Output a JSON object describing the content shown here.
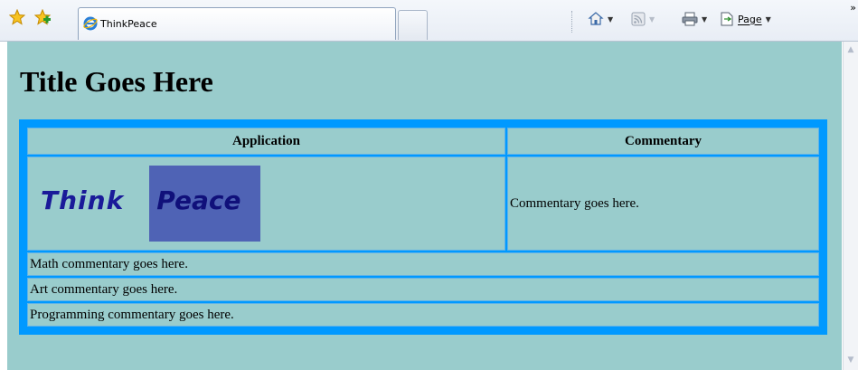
{
  "browser": {
    "tab_title": "ThinkPeace",
    "page_menu_label": "Page",
    "overflow_label": "»"
  },
  "page": {
    "title": "Title Goes Here",
    "table": {
      "headers": [
        "Application",
        "Commentary"
      ],
      "logo_words": [
        "Think",
        "Peace"
      ],
      "commentary": "Commentary goes here.",
      "rows": [
        "Math commentary goes here.",
        "Art commentary goes here.",
        "Programming commentary goes here."
      ]
    }
  },
  "colors": {
    "page_background": "#99cccc",
    "table_border": "#0099ff",
    "logo_box": "#4f63b5",
    "logo_text": "#1a1a99"
  }
}
